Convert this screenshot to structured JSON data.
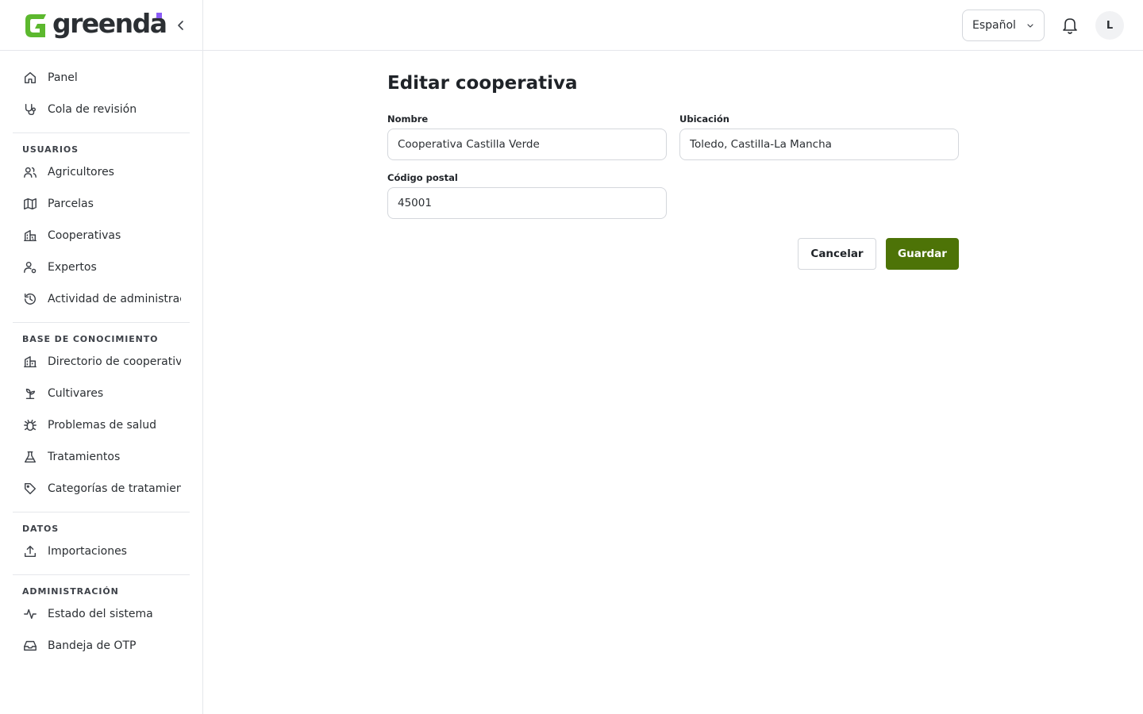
{
  "app": {
    "brand": "greenda",
    "colors": {
      "accent": "#4d7307",
      "logo_green": "#5cb82e",
      "logo_dot": "#8b5cf6"
    }
  },
  "sidebar": {
    "collapse_icon": "chevron-left-icon",
    "groups": [
      {
        "title": "",
        "items": [
          {
            "label": "Panel",
            "icon": "home-icon"
          },
          {
            "label": "Cola de revisión",
            "icon": "stethoscope-icon"
          }
        ]
      },
      {
        "title": "USUARIOS",
        "items": [
          {
            "label": "Agricultores",
            "icon": "users-icon"
          },
          {
            "label": "Parcelas",
            "icon": "map-icon"
          },
          {
            "label": "Cooperativas",
            "icon": "building-icon"
          },
          {
            "label": "Expertos",
            "icon": "user-cog-icon"
          },
          {
            "label": "Actividad de administración",
            "icon": "history-icon"
          }
        ]
      },
      {
        "title": "BASE DE CONOCIMIENTO",
        "items": [
          {
            "label": "Directorio de cooperativas",
            "icon": "building-icon"
          },
          {
            "label": "Cultivares",
            "icon": "sprout-icon"
          },
          {
            "label": "Problemas de salud",
            "icon": "bug-icon"
          },
          {
            "label": "Tratamientos",
            "icon": "flask-icon"
          },
          {
            "label": "Categorías de tratamientos",
            "icon": "tag-icon"
          }
        ]
      },
      {
        "title": "DATOS",
        "items": [
          {
            "label": "Importaciones",
            "icon": "upload-icon"
          }
        ]
      },
      {
        "title": "ADMINISTRACIÓN",
        "items": [
          {
            "label": "Estado del sistema",
            "icon": "activity-icon"
          },
          {
            "label": "Bandeja de OTP",
            "icon": "inbox-icon"
          }
        ]
      }
    ]
  },
  "header": {
    "language": "Español",
    "bell_icon": "bell-icon",
    "avatar_initial": "L"
  },
  "main": {
    "title": "Editar cooperativa",
    "fields": {
      "name": {
        "label": "Nombre",
        "value": "Cooperativa Castilla Verde"
      },
      "location": {
        "label": "Ubicación",
        "value": "Toledo, Castilla-La Mancha"
      },
      "postal_code": {
        "label": "Código postal",
        "value": "45001"
      }
    },
    "actions": {
      "cancel": "Cancelar",
      "save": "Guardar"
    }
  }
}
